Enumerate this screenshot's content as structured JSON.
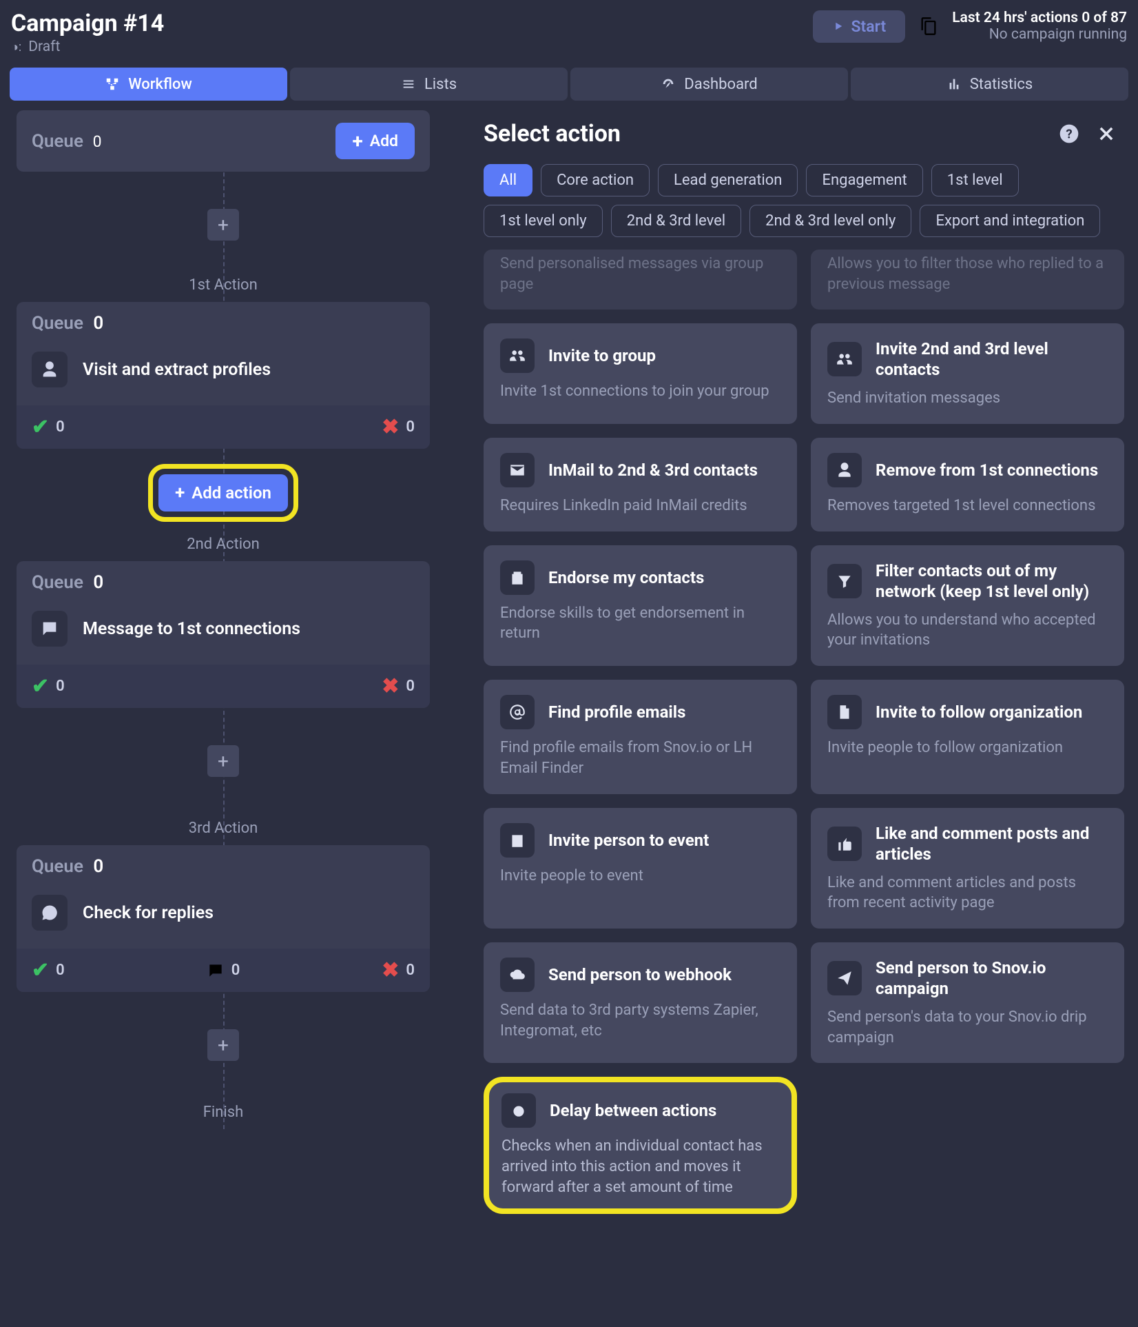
{
  "header": {
    "title": "Campaign #14",
    "status": "Draft",
    "start": "Start",
    "lastActions": "Last 24 hrs' actions 0 of 87",
    "running": "No campaign running"
  },
  "nav": {
    "workflow": "Workflow",
    "lists": "Lists",
    "dashboard": "Dashboard",
    "statistics": "Statistics"
  },
  "flow": {
    "queueLabel": "Queue",
    "queueTop": "0",
    "add": "Add",
    "stage1": "1st Action",
    "stage2": "2nd Action",
    "stage3": "3rd Action",
    "finish": "Finish",
    "addAction": "Add action",
    "actions": [
      {
        "name": "Visit and extract profiles",
        "queue": "0",
        "ok": "0",
        "fail": "0",
        "variant": "a"
      },
      {
        "name": "Message to 1st connections",
        "queue": "0",
        "ok": "0",
        "fail": "0",
        "variant": "a"
      },
      {
        "name": "Check for replies",
        "queue": "0",
        "ok": "0",
        "mid": "0",
        "fail": "0",
        "variant": "b"
      }
    ]
  },
  "panel": {
    "title": "Select action",
    "chips": [
      "All",
      "Core action",
      "Lead generation",
      "Engagement",
      "1st level",
      "1st level only",
      "2nd & 3rd level",
      "2nd & 3rd level only",
      "Export and integration"
    ],
    "cutoff": [
      {
        "desc": "Send personalised messages via group page"
      },
      {
        "desc": "Allows you to filter those who replied to a previous message"
      }
    ],
    "cards": [
      {
        "icon": "group-add",
        "title": "Invite to group",
        "desc": "Invite 1st connections to join your group"
      },
      {
        "icon": "users",
        "title": "Invite 2nd and 3rd level contacts",
        "desc": "Send invitation messages"
      },
      {
        "icon": "mail",
        "title": "InMail to 2nd & 3rd contacts",
        "desc": "Requires LinkedIn paid InMail credits"
      },
      {
        "icon": "user-minus",
        "title": "Remove from 1st connections",
        "desc": "Removes targeted 1st level connections"
      },
      {
        "icon": "clipboard",
        "title": "Endorse my contacts",
        "desc": "Endorse skills to get endorsement in return"
      },
      {
        "icon": "filter",
        "title": "Filter contacts out of my network (keep 1st level only)",
        "desc": "Allows you to understand who accepted your invitations"
      },
      {
        "icon": "at",
        "title": "Find profile emails",
        "desc": "Find profile emails from Snov.io or LH Email Finder"
      },
      {
        "icon": "building",
        "title": "Invite to follow organization",
        "desc": "Invite people to follow organization"
      },
      {
        "icon": "calendar",
        "title": "Invite person to event",
        "desc": "Invite people to event"
      },
      {
        "icon": "thumb",
        "title": "Like and comment posts and articles",
        "desc": "Like and comment articles and posts from recent activity page"
      },
      {
        "icon": "cloud",
        "title": "Send person to webhook",
        "desc": "Send data to 3rd party systems Zapier, Integromat, etc"
      },
      {
        "icon": "send",
        "title": "Send person to Snov.io campaign",
        "desc": "Send person's data to your Snov.io drip campaign"
      },
      {
        "icon": "timer",
        "title": "Delay between actions",
        "desc": "Checks when an individual contact has arrived into this action and moves it forward after a set amount of time",
        "highlight": true
      }
    ]
  }
}
